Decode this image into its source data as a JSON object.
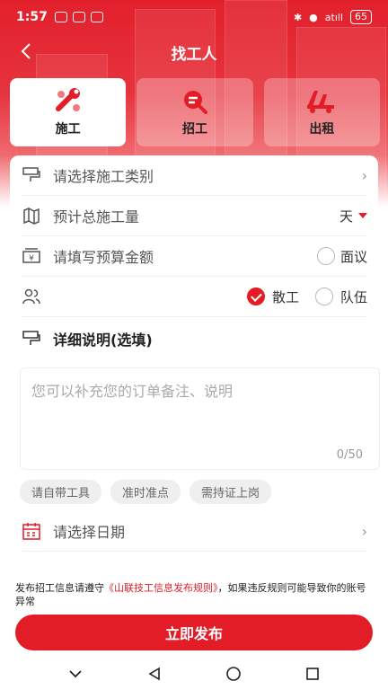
{
  "status_bar": {
    "time": "1:57",
    "signal": "atıll",
    "battery": "65"
  },
  "nav": {
    "title": "找工人"
  },
  "categories": [
    {
      "label": "施工",
      "icon": "wrench-icon",
      "active": true
    },
    {
      "label": "招工",
      "icon": "recruit-icon",
      "active": false
    },
    {
      "label": "出租",
      "icon": "rent-icon",
      "active": false
    }
  ],
  "form": {
    "category_placeholder": "请选择施工类别",
    "quantity_placeholder": "预计总施工量",
    "quantity_unit": "天",
    "budget_placeholder": "请填写预算金额",
    "negotiable_label": "面议",
    "worker_type": {
      "option1": "散工",
      "option2": "队伍",
      "selected": "散工"
    },
    "details_title": "详细说明(选填)",
    "notes_placeholder": "您可以补充您的订单备注、说明",
    "notes_count": "0/50",
    "tags": [
      "请自带工具",
      "准时准点",
      "需持证上岗"
    ],
    "date_placeholder": "请选择日期"
  },
  "footer": {
    "rule_prefix": "发布招工信息请遵守",
    "rule_link": "《山联技工信息发布规则》",
    "rule_suffix": "，如果违反规则可能导致你的账号异常",
    "publish_button": "立即发布"
  },
  "colors": {
    "accent": "#e31d27"
  }
}
